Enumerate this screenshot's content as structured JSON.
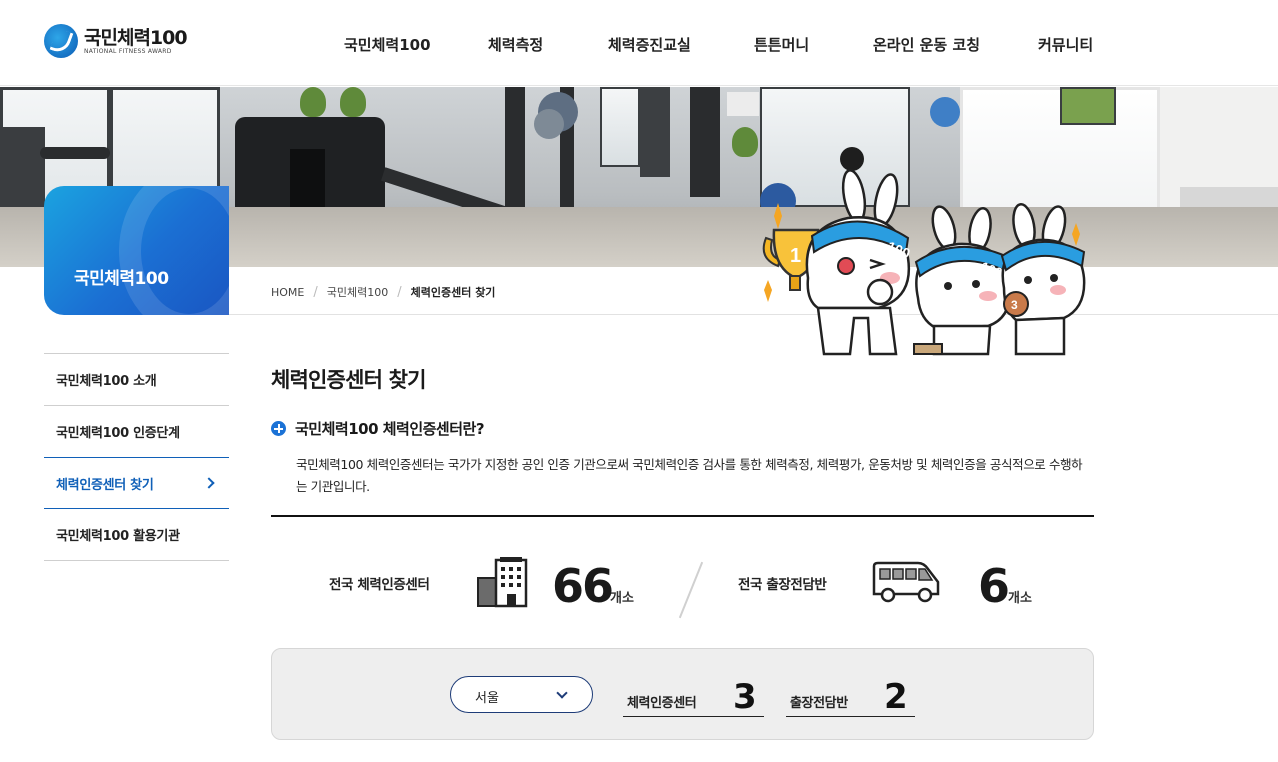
{
  "header": {
    "logo": {
      "main": "국민체력100",
      "sub": "NATIONAL FITNESS AWARD"
    },
    "nav": [
      "국민체력100",
      "체력측정",
      "체력증진교실",
      "튼튼머니",
      "온라인 운동 코칭",
      "커뮤니티"
    ]
  },
  "side_card": {
    "title": "국민체력100"
  },
  "breadcrumb": {
    "home": "HOME",
    "level1": "국민체력100",
    "current": "체력인증센터 찾기"
  },
  "side_menu": [
    {
      "label": "국민체력100 소개"
    },
    {
      "label": "국민체력100 인증단계"
    },
    {
      "label": "체력인증센터 찾기"
    },
    {
      "label": "국민체력100 활용기관"
    }
  ],
  "main": {
    "title": "체력인증센터 찾기",
    "sub_heading": "국민체력100 체력인증센터란?",
    "description": "국민체력100 체력인증센터는 국가가 지정한 공인 인증 기관으로써 국민체력인증 검사를 통한 체력측정, 체력평가, 운동처방 및 체력인증을 공식적으로 수행하는 기관입니다."
  },
  "stats": {
    "centers": {
      "label": "전국 체력인증센터",
      "value": "66",
      "unit": "개소"
    },
    "mobile": {
      "label": "전국 출장전담반",
      "value": "6",
      "unit": "개소"
    }
  },
  "filter": {
    "region": "서울",
    "center_label": "체력인증센터",
    "center_value": "3",
    "mobile_label": "출장전담반",
    "mobile_value": "2"
  },
  "colors": {
    "accent": "#1060b8",
    "brand_blue": "#1b72d6"
  }
}
